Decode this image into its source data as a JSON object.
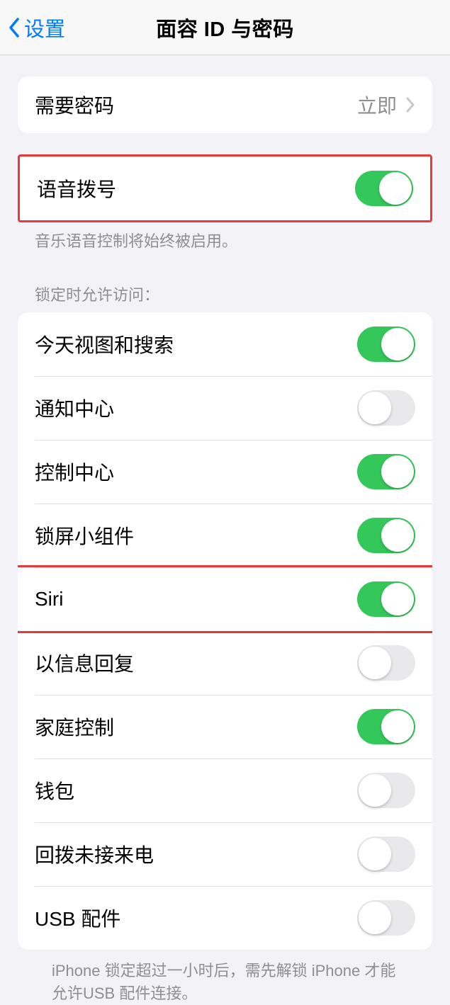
{
  "nav": {
    "back_label": "设置",
    "title": "面容 ID 与密码"
  },
  "require_passcode": {
    "label": "需要密码",
    "value": "立即"
  },
  "voice_dial": {
    "label": "语音拨号",
    "footer": "音乐语音控制将始终被启用。",
    "on": true
  },
  "locked_access": {
    "header": "锁定时允许访问：",
    "items": [
      {
        "label": "今天视图和搜索",
        "on": true
      },
      {
        "label": "通知中心",
        "on": false
      },
      {
        "label": "控制中心",
        "on": true
      },
      {
        "label": "锁屏小组件",
        "on": true
      },
      {
        "label": "Siri",
        "on": true
      },
      {
        "label": "以信息回复",
        "on": false
      },
      {
        "label": "家庭控制",
        "on": true
      },
      {
        "label": "钱包",
        "on": false
      },
      {
        "label": "回拨未接来电",
        "on": false
      },
      {
        "label": "USB 配件",
        "on": false
      }
    ],
    "footer": "iPhone 锁定超过一小时后，需先解锁 iPhone 才能允许USB 配件连接。"
  }
}
